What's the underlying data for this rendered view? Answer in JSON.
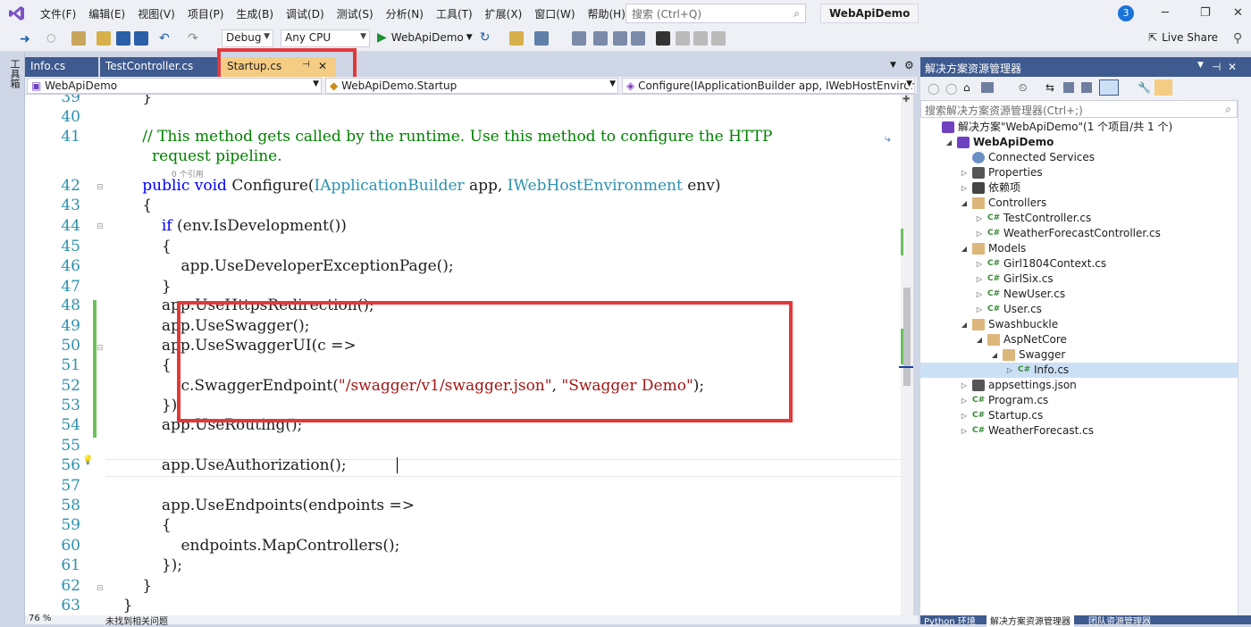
{
  "menu": {
    "items": [
      "文件(F)",
      "编辑(E)",
      "视图(V)",
      "项目(P)",
      "生成(B)",
      "调试(D)",
      "测试(S)",
      "分析(N)",
      "工具(T)",
      "扩展(X)",
      "窗口(W)",
      "帮助(H)"
    ]
  },
  "search": {
    "placeholder": "搜索 (Ctrl+Q)"
  },
  "title": {
    "project": "WebApiDemo",
    "notifications": "3"
  },
  "toolbar": {
    "config": "Debug",
    "platform": "Any CPU",
    "run_target": "WebApiDemo",
    "live_share": "Live Share"
  },
  "left_strip": {
    "label": "工具箱"
  },
  "tabs": [
    {
      "label": "Info.cs"
    },
    {
      "label": "TestController.cs"
    },
    {
      "label": "Startup.cs",
      "pin": "⊣",
      "close": "✕"
    }
  ],
  "navbar": {
    "project": "WebApiDemo",
    "class": "WebApiDemo.Startup",
    "member": "Configure(IApplicationBuilder app, IWebHostEnvironment"
  },
  "editor": {
    "refs_label": "0 个引用",
    "lines": [
      {
        "n": "39",
        "t": "        }"
      },
      {
        "n": "40",
        "t": ""
      },
      {
        "n": "41",
        "t": "        // This method gets called by the runtime. Use this method to configure the HTTP"
      },
      {
        "n": "",
        "t": "          request pipeline."
      },
      {
        "n": "42",
        "t": "        public void Configure(IApplicationBuilder app, IWebHostEnvironment env)"
      },
      {
        "n": "43",
        "t": "        {"
      },
      {
        "n": "44",
        "t": "            if (env.IsDevelopment())"
      },
      {
        "n": "45",
        "t": "            {"
      },
      {
        "n": "46",
        "t": "                app.UseDeveloperExceptionPage();"
      },
      {
        "n": "47",
        "t": "            }"
      },
      {
        "n": "48",
        "t": "            app.UseHttpsRedirection();"
      },
      {
        "n": "49",
        "t": "            app.UseSwagger();"
      },
      {
        "n": "50",
        "t": "            app.UseSwaggerUI(c =>"
      },
      {
        "n": "51",
        "t": "            {"
      },
      {
        "n": "52",
        "t": "                c.SwaggerEndpoint(\"/swagger/v1/swagger.json\", \"Swagger Demo\");"
      },
      {
        "n": "53",
        "t": "            });"
      },
      {
        "n": "54",
        "t": "            app.UseRouting();"
      },
      {
        "n": "55",
        "t": ""
      },
      {
        "n": "56",
        "t": "            app.UseAuthorization();"
      },
      {
        "n": "57",
        "t": ""
      },
      {
        "n": "58",
        "t": "            app.UseEndpoints(endpoints =>"
      },
      {
        "n": "59",
        "t": "            {"
      },
      {
        "n": "60",
        "t": "                endpoints.MapControllers();"
      },
      {
        "n": "61",
        "t": "            });"
      },
      {
        "n": "62",
        "t": "        }"
      },
      {
        "n": "63",
        "t": "    }"
      }
    ]
  },
  "solution_explorer": {
    "title": "解决方案资源管理器",
    "search_placeholder": "搜索解决方案资源管理器(Ctrl+;)",
    "nodes": [
      {
        "label": "解决方案\"WebApiDemo\"(1 个项目/共 1 个)",
        "icon": "solution-icon"
      },
      {
        "label": "WebApiDemo",
        "icon": "project-icon"
      },
      {
        "label": "Connected Services",
        "icon": "connected-services-icon"
      },
      {
        "label": "Properties",
        "icon": "properties-icon"
      },
      {
        "label": "依赖项",
        "icon": "dependencies-icon"
      },
      {
        "label": "Controllers",
        "icon": "folder-icon"
      },
      {
        "label": "TestController.cs",
        "icon": "csharp-file-icon"
      },
      {
        "label": "WeatherForecastController.cs",
        "icon": "csharp-file-icon"
      },
      {
        "label": "Models",
        "icon": "folder-icon"
      },
      {
        "label": "Girl1804Context.cs",
        "icon": "csharp-file-icon"
      },
      {
        "label": "GirlSix.cs",
        "icon": "csharp-file-icon"
      },
      {
        "label": "NewUser.cs",
        "icon": "csharp-file-icon"
      },
      {
        "label": "User.cs",
        "icon": "csharp-file-icon"
      },
      {
        "label": "Swashbuckle",
        "icon": "folder-icon"
      },
      {
        "label": "AspNetCore",
        "icon": "folder-icon"
      },
      {
        "label": "Swagger",
        "icon": "folder-icon"
      },
      {
        "label": "Info.cs",
        "icon": "csharp-file-icon"
      },
      {
        "label": "appsettings.json",
        "icon": "json-file-icon"
      },
      {
        "label": "Program.cs",
        "icon": "csharp-file-icon"
      },
      {
        "label": "Startup.cs",
        "icon": "csharp-file-icon"
      },
      {
        "label": "WeatherForecast.cs",
        "icon": "csharp-file-icon"
      }
    ]
  },
  "statusbar": {
    "zoom": "76 %",
    "issues": "未找到相关问题"
  },
  "bottom_tabs": {
    "python": "Python 环境",
    "solution": "解决方案资源管理器",
    "team": "团队资源管理器"
  },
  "colors": {
    "highlight_red": "#e2383a",
    "active_tab": "#f5cc84",
    "panel_blue": "#3e5a8f",
    "keyword": "#0000ff",
    "type": "#2b91af",
    "comment": "#008000",
    "string": "#a31515"
  }
}
